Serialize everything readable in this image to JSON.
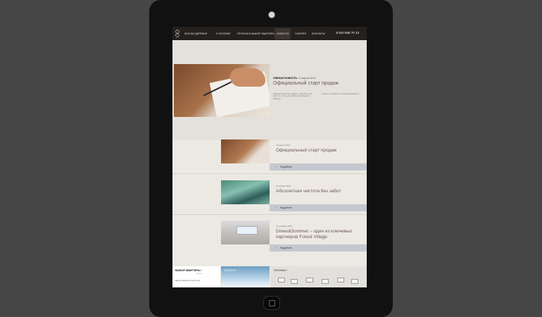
{
  "nav": {
    "brand": "ЛЕСНАЯ ДЕРЕВНЯ",
    "items": [
      "О ПОСЕЛКЕ",
      "ГЕНПЛАН И ВЫБОР КВАРТИРЫ",
      "НОВОСТИ",
      "ГАЛЕРЕЯ",
      "КОНТАКТЫ"
    ],
    "phone": "8 910 506 70 13"
  },
  "featured": {
    "label": "СВЕЖАЯ НОВОСТЬ",
    "date": "/ 2 апреля 2014",
    "title": "Официальный старт продаж",
    "text_left": "Официальный старт продаж – май 2014 года. Для того, чтобы уже сейчас забронировать квартиру,",
    "text_right": "позвоните, связаться с нашим менеджером."
  },
  "news": [
    {
      "date": "4 апреля 2014",
      "title": "Официальный старт продаж",
      "more": "Подробнее"
    },
    {
      "date": "22 января 2014",
      "title": "Абсолютная чистота без забот",
      "more": "Подробнее"
    },
    {
      "date": "15 декабря 2013",
      "title": "Drees&Sommer – один из ключевых партнеров Forest Village",
      "more": "Подробнее"
    }
  ],
  "bottom": {
    "choose": "ВЫБОР КВАРТИРЫ /",
    "choose_sub": "Двухуровневый жилой дом",
    "gallery": "ГАЛЕРЕЯ /",
    "genplan": "ГЕНПЛАН /"
  },
  "icons": {
    "more": "arrow-icon"
  }
}
